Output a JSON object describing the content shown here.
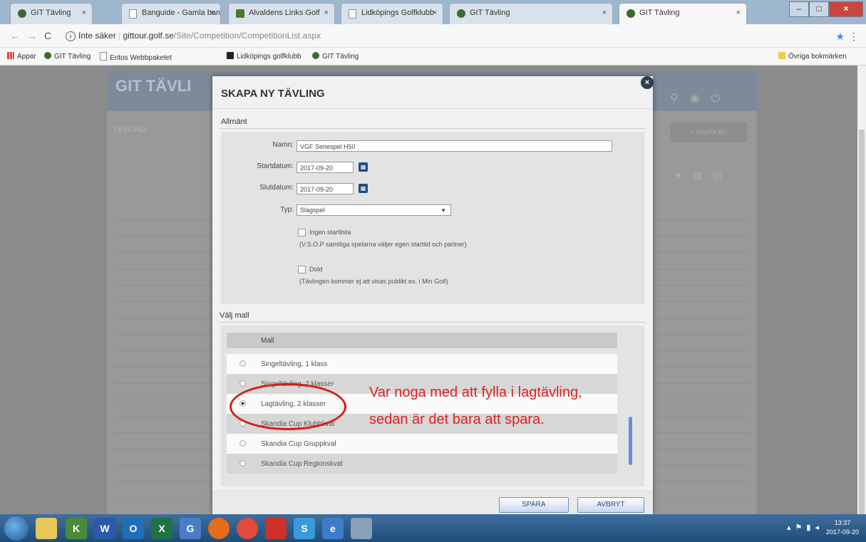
{
  "browser": {
    "tabs": [
      {
        "label": "GIT Tävling",
        "icon": "globe-icon"
      },
      {
        "label": "Banguide - Gamla ban",
        "icon": "document-icon"
      },
      {
        "label": "Alvaldens Links Golf",
        "icon": "golf-icon"
      },
      {
        "label": "Lidköpings Golfklubb",
        "icon": "document-icon"
      },
      {
        "label": "GIT Tävling",
        "icon": "globe-icon"
      },
      {
        "label": "GIT Tävling",
        "icon": "globe-icon"
      }
    ],
    "security": "Inte säker",
    "url_host": "gittour.golf.se",
    "url_path": "/Site/Competition/CompetitionList.aspx",
    "bookmarks": [
      "Appar",
      "GIT Tävling",
      "Eritos Webbpaketet",
      "Lidköpings golfklubb",
      "GIT Tävling"
    ],
    "other_bookmarks": "Övriga bokmärken"
  },
  "background_page": {
    "logo": "GIT TÄVLI",
    "title": "TÄVLING",
    "create_button": "SKAPA NY"
  },
  "modal": {
    "title": "SKAPA NY TÄVLING",
    "close": "×",
    "general_section": "Allmänt",
    "name_label": "Namn:",
    "name_value": "VGF Seriespel H50",
    "start_label": "Startdatum:",
    "start_value": "2017-09-20",
    "end_label": "Slutdatum:",
    "end_value": "2017-09-20",
    "type_label": "Typ:",
    "type_value": "Slagspel",
    "no_startlist_label": "Ingen startlista",
    "no_startlist_hint": "(V.S.O.P samtliga spelarna väljer egen starttid och partner)",
    "hidden_label": "Dold",
    "hidden_hint": "(Tävlingen kommer ej att visas publikt ex. i Min Golf)",
    "template_section": "Välj mall",
    "table_header": "Mall",
    "templates": [
      {
        "label": "Singeltävling, 1 klass",
        "selected": false
      },
      {
        "label": "Singeltävling, 2 klasser",
        "selected": false
      },
      {
        "label": "Lagtävling, 2 klasser",
        "selected": true
      },
      {
        "label": "Skandia Cup Klubbkval",
        "selected": false
      },
      {
        "label": "Skandia Cup Gruppkval",
        "selected": false
      },
      {
        "label": "Skandia Cup Regionskval",
        "selected": false
      }
    ],
    "save_button": "SPARA",
    "cancel_button": "AVBRYT"
  },
  "annotation": {
    "line1": "Var noga med att fylla i lagtävling,",
    "line2": "sedan är det bara att spara.",
    "color": "#e02020"
  },
  "taskbar": {
    "time": "13:37",
    "date": "2017-09-20"
  }
}
